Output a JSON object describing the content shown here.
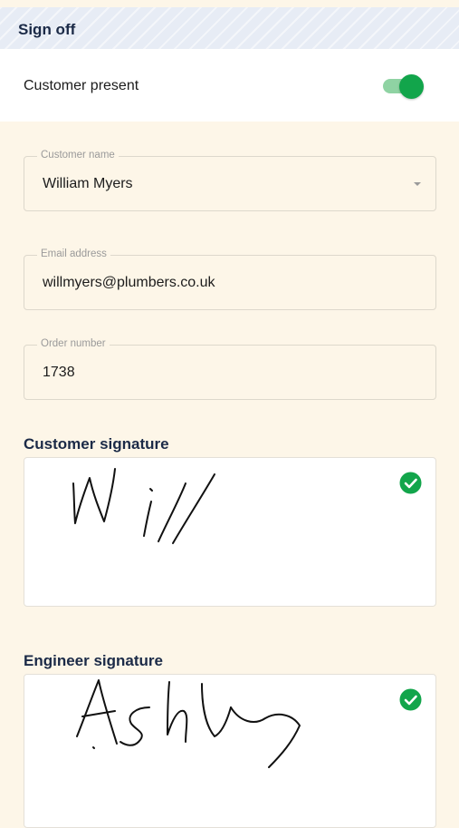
{
  "header": {
    "title": "Sign off"
  },
  "customer_present": {
    "label": "Customer present",
    "on": true
  },
  "fields": {
    "customer_name": {
      "label": "Customer name",
      "value": "William Myers"
    },
    "email": {
      "label": "Email address",
      "value": "willmyers@plumbers.co.uk"
    },
    "order_number": {
      "label": "Order number",
      "value": "1738"
    }
  },
  "customer_signature": {
    "label": "Customer signature",
    "signed": true,
    "status_icon": "check-circle-icon"
  },
  "engineer_signature": {
    "label": "Engineer signature",
    "signed": true,
    "status_icon": "check-circle-icon"
  },
  "colors": {
    "accent_green": "#12a54b",
    "heading_navy": "#1b2a47",
    "panel_bg": "#fdf6e8"
  }
}
